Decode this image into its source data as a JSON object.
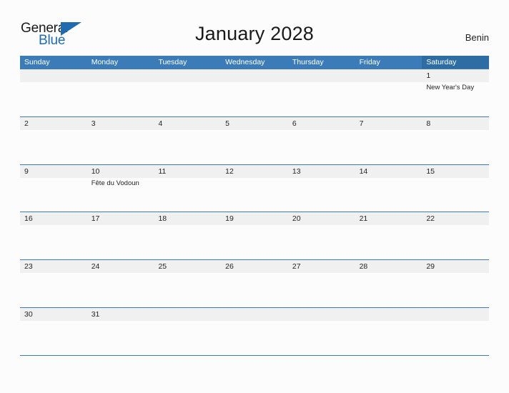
{
  "brand": {
    "name_part1": "General",
    "name_part2": "Blue",
    "triangle_icon": "triangle-icon",
    "color_primary": "#1f6bb0",
    "color_text": "#1a1a1a"
  },
  "header": {
    "title": "January 2028",
    "country": "Benin"
  },
  "calendar": {
    "header_color": "#3b7cb8",
    "saturday_header_color": "#2e6da4",
    "band_color": "#f0f0f0",
    "weekdays": [
      "Sunday",
      "Monday",
      "Tuesday",
      "Wednesday",
      "Thursday",
      "Friday",
      "Saturday"
    ],
    "weeks": [
      {
        "days": [
          {
            "num": "",
            "event": ""
          },
          {
            "num": "",
            "event": ""
          },
          {
            "num": "",
            "event": ""
          },
          {
            "num": "",
            "event": ""
          },
          {
            "num": "",
            "event": ""
          },
          {
            "num": "",
            "event": ""
          },
          {
            "num": "1",
            "event": "New Year's Day"
          }
        ]
      },
      {
        "days": [
          {
            "num": "2",
            "event": ""
          },
          {
            "num": "3",
            "event": ""
          },
          {
            "num": "4",
            "event": ""
          },
          {
            "num": "5",
            "event": ""
          },
          {
            "num": "6",
            "event": ""
          },
          {
            "num": "7",
            "event": ""
          },
          {
            "num": "8",
            "event": ""
          }
        ]
      },
      {
        "days": [
          {
            "num": "9",
            "event": ""
          },
          {
            "num": "10",
            "event": "Fête du Vodoun"
          },
          {
            "num": "11",
            "event": ""
          },
          {
            "num": "12",
            "event": ""
          },
          {
            "num": "13",
            "event": ""
          },
          {
            "num": "14",
            "event": ""
          },
          {
            "num": "15",
            "event": ""
          }
        ]
      },
      {
        "days": [
          {
            "num": "16",
            "event": ""
          },
          {
            "num": "17",
            "event": ""
          },
          {
            "num": "18",
            "event": ""
          },
          {
            "num": "19",
            "event": ""
          },
          {
            "num": "20",
            "event": ""
          },
          {
            "num": "21",
            "event": ""
          },
          {
            "num": "22",
            "event": ""
          }
        ]
      },
      {
        "days": [
          {
            "num": "23",
            "event": ""
          },
          {
            "num": "24",
            "event": ""
          },
          {
            "num": "25",
            "event": ""
          },
          {
            "num": "26",
            "event": ""
          },
          {
            "num": "27",
            "event": ""
          },
          {
            "num": "28",
            "event": ""
          },
          {
            "num": "29",
            "event": ""
          }
        ]
      },
      {
        "days": [
          {
            "num": "30",
            "event": ""
          },
          {
            "num": "31",
            "event": ""
          },
          {
            "num": "",
            "event": ""
          },
          {
            "num": "",
            "event": ""
          },
          {
            "num": "",
            "event": ""
          },
          {
            "num": "",
            "event": ""
          },
          {
            "num": "",
            "event": ""
          }
        ]
      }
    ]
  }
}
